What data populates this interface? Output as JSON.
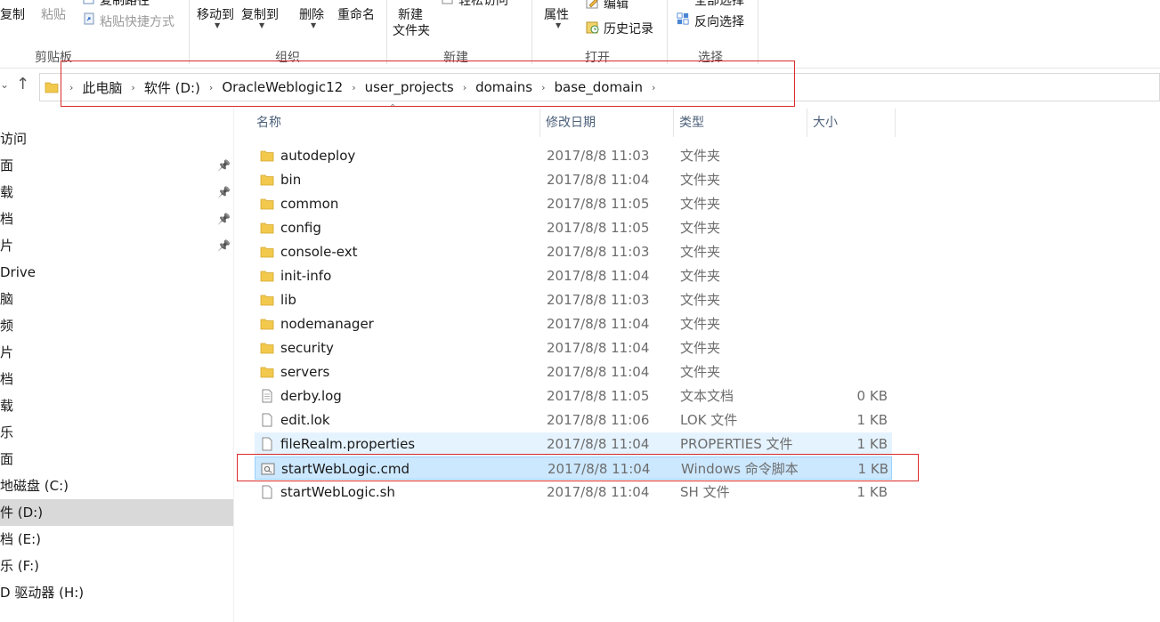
{
  "ribbon": {
    "copy_label": "复制",
    "paste_label": "粘贴",
    "copy_path_label": "复制路径",
    "paste_shortcut_label": "粘贴快捷方式",
    "move_to_label": "移动到",
    "copy_to_label": "复制到",
    "delete_label": "删除",
    "rename_label": "重命名",
    "new_folder_line1": "新建",
    "new_folder_line2": "文件夹",
    "easy_access_label": "轻松访问",
    "properties_label": "属性",
    "edit_label": "编辑",
    "history_label": "历史记录",
    "select_all_label": "全部选择",
    "invert_selection_label": "反向选择",
    "groups": {
      "clipboard": "剪贴板",
      "organize": "组织",
      "new": "新建",
      "open": "打开",
      "select": "选择"
    }
  },
  "address": {
    "crumbs": [
      "此电脑",
      "软件 (D:)",
      "OracleWeblogic12",
      "user_projects",
      "domains",
      "base_domain"
    ]
  },
  "nav": {
    "items": [
      {
        "label": "访问",
        "pinned": false
      },
      {
        "label": "面",
        "pinned": true
      },
      {
        "label": "载",
        "pinned": true
      },
      {
        "label": "档",
        "pinned": true
      },
      {
        "label": "片",
        "pinned": true
      },
      {
        "label": "Drive",
        "pinned": false
      },
      {
        "label": "脑",
        "pinned": false
      },
      {
        "label": "频",
        "pinned": false
      },
      {
        "label": "片",
        "pinned": false
      },
      {
        "label": "档",
        "pinned": false
      },
      {
        "label": "载",
        "pinned": false
      },
      {
        "label": "乐",
        "pinned": false
      },
      {
        "label": "面",
        "pinned": false
      },
      {
        "label": "地磁盘 (C:)",
        "pinned": false
      },
      {
        "label": "件 (D:)",
        "pinned": false,
        "selected": true
      },
      {
        "label": "档 (E:)",
        "pinned": false
      },
      {
        "label": "乐 (F:)",
        "pinned": false
      },
      {
        "label": "D 驱动器 (H:)",
        "pinned": false
      }
    ]
  },
  "columns": {
    "name": "名称",
    "modified": "修改日期",
    "type": "类型",
    "size": "大小"
  },
  "files": [
    {
      "name": "autodeploy",
      "date": "2017/8/8 11:03",
      "type": "文件夹",
      "size": "",
      "icon": "folder-icon"
    },
    {
      "name": "bin",
      "date": "2017/8/8 11:04",
      "type": "文件夹",
      "size": "",
      "icon": "folder-icon"
    },
    {
      "name": "common",
      "date": "2017/8/8 11:05",
      "type": "文件夹",
      "size": "",
      "icon": "folder-icon"
    },
    {
      "name": "config",
      "date": "2017/8/8 11:05",
      "type": "文件夹",
      "size": "",
      "icon": "folder-icon"
    },
    {
      "name": "console-ext",
      "date": "2017/8/8 11:03",
      "type": "文件夹",
      "size": "",
      "icon": "folder-icon"
    },
    {
      "name": "init-info",
      "date": "2017/8/8 11:04",
      "type": "文件夹",
      "size": "",
      "icon": "folder-icon"
    },
    {
      "name": "lib",
      "date": "2017/8/8 11:03",
      "type": "文件夹",
      "size": "",
      "icon": "folder-icon"
    },
    {
      "name": "nodemanager",
      "date": "2017/8/8 11:04",
      "type": "文件夹",
      "size": "",
      "icon": "folder-icon"
    },
    {
      "name": "security",
      "date": "2017/8/8 11:04",
      "type": "文件夹",
      "size": "",
      "icon": "folder-icon"
    },
    {
      "name": "servers",
      "date": "2017/8/8 11:04",
      "type": "文件夹",
      "size": "",
      "icon": "folder-icon"
    },
    {
      "name": "derby.log",
      "date": "2017/8/8 11:05",
      "type": "文本文档",
      "size": "0 KB",
      "icon": "text-file-icon"
    },
    {
      "name": "edit.lok",
      "date": "2017/8/8 11:06",
      "type": "LOK 文件",
      "size": "1 KB",
      "icon": "file-icon"
    },
    {
      "name": "fileRealm.properties",
      "date": "2017/8/8 11:04",
      "type": "PROPERTIES 文件",
      "size": "1 KB",
      "icon": "file-icon",
      "state": "hover"
    },
    {
      "name": "startWebLogic.cmd",
      "date": "2017/8/8 11:04",
      "type": "Windows 命令脚本",
      "size": "1 KB",
      "icon": "cmd-script-icon",
      "state": "selected"
    },
    {
      "name": "startWebLogic.sh",
      "date": "2017/8/8 11:04",
      "type": "SH 文件",
      "size": "1 KB",
      "icon": "file-icon"
    }
  ],
  "colors": {
    "selection_bg": "#cce8ff",
    "hover_bg": "#e5f3ff",
    "highlight_red": "#d92b2b",
    "folder_yellow": "#f2c94c"
  }
}
